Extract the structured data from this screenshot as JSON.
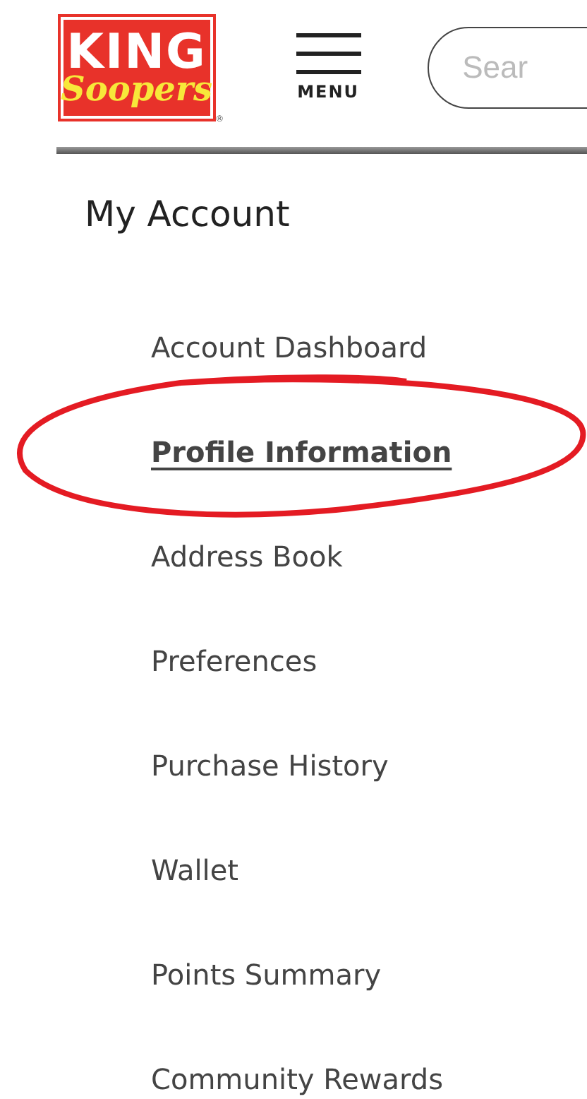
{
  "header": {
    "logo": {
      "line_1": "KING",
      "line_2": "Soopers",
      "mark": "®"
    },
    "menu_label": "MENU",
    "search": {
      "placeholder": "Sear"
    }
  },
  "sidebar": {
    "title": "My Account",
    "items": [
      {
        "label": "Account Dashboard",
        "selected": false
      },
      {
        "label": "Profile Information",
        "selected": true
      },
      {
        "label": "Address Book",
        "selected": false
      },
      {
        "label": "Preferences",
        "selected": false
      },
      {
        "label": "Purchase History",
        "selected": false
      },
      {
        "label": "Wallet",
        "selected": false
      },
      {
        "label": "Points Summary",
        "selected": false
      },
      {
        "label": "Community Rewards",
        "selected": false
      }
    ]
  }
}
